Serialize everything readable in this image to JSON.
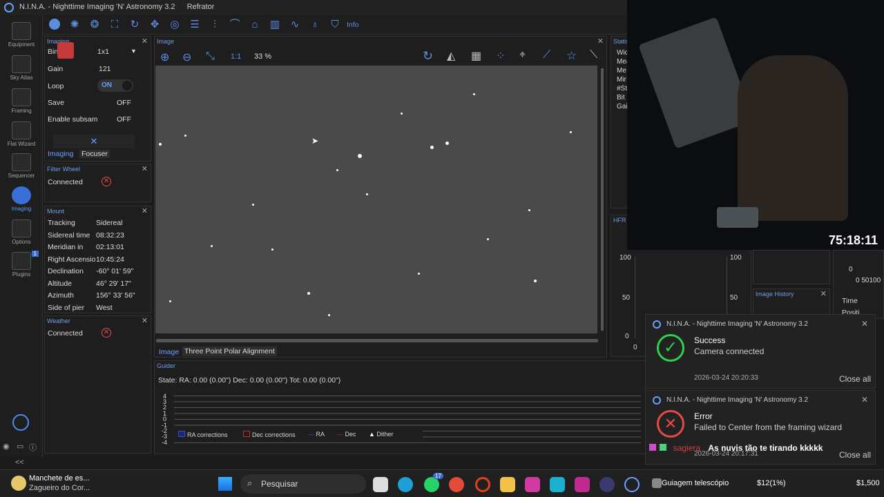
{
  "window": {
    "title": "N.I.N.A. - Nighttime Imaging 'N' Astronomy 3.2",
    "profile": "Refrator"
  },
  "nav": [
    "Equipment",
    "Sky Atlas",
    "Framing",
    "Flat Wizard",
    "Sequencer",
    "Imaging",
    "Options",
    "Plugins"
  ],
  "plugins_badge": "1",
  "toolbar": {
    "info_label": "Info"
  },
  "imaging_panel": {
    "header": "Imaging",
    "bin_label": "Bin",
    "bin_value": "1x1",
    "gain_label": "Gain",
    "gain_value": "121",
    "loop_label": "Loop",
    "loop_value": "ON",
    "save_label": "Save",
    "save_value": "OFF",
    "subsam_label": "Enable subsam",
    "subsam_value": "OFF",
    "tabs": [
      "Imaging",
      "Focuser"
    ]
  },
  "filter_wheel": {
    "header": "Filter Wheel",
    "status": "Connected"
  },
  "mount": {
    "header": "Mount",
    "rows": [
      {
        "label": "Tracking",
        "value": "Sidereal"
      },
      {
        "label": "Sidereal time",
        "value": "08:32:23"
      },
      {
        "label": "Meridian in",
        "value": "02:13:01"
      },
      {
        "label": "Right Ascensio",
        "value": "10:45:24"
      },
      {
        "label": "Declination",
        "value": "-60° 01' 59\""
      },
      {
        "label": "Altitude",
        "value": "46° 29' 17\""
      },
      {
        "label": "Azimuth",
        "value": "156° 33' 56\""
      },
      {
        "label": "Side of pier",
        "value": "West"
      }
    ]
  },
  "weather": {
    "header": "Weather",
    "status": "Connected"
  },
  "image_panel": {
    "header": "Image",
    "ratio": "1:1",
    "zoom": "33 %",
    "tabs": [
      "Image",
      "Three Point Polar Alignment"
    ]
  },
  "statistics": {
    "header": "Statisti",
    "rows": [
      "Wic",
      "Mea",
      "Me",
      "Mir",
      "#St",
      "Bit",
      "Gai"
    ]
  },
  "hfr": {
    "header": "HFR H",
    "y_ticks": [
      "100",
      "50",
      "0"
    ],
    "x0": "0"
  },
  "right_panel": {
    "ticks": [
      "0",
      "0 50100"
    ],
    "image_history": "Image History",
    "time_label": "Time",
    "position_label": "Positi"
  },
  "guider": {
    "header": "Guider",
    "state": "State:  RA: 0.00 (0.00\")  Dec: 0.00 (0.00\")  Tot: 0.00 (0.00\")",
    "y_ticks": [
      "4",
      "3",
      "2",
      "1",
      "0",
      "-1",
      "-2",
      "-3",
      "-4"
    ],
    "legend": [
      "RA corrections",
      "Dec corrections",
      "RA",
      "Dec",
      "Dither"
    ]
  },
  "stream": {
    "timer": "75:18:11",
    "chat_user": "sagiera",
    "chat_message": "As nuvis tão te tirando kkkkk"
  },
  "toasts": [
    {
      "app": "N.I.N.A. - Nighttime Imaging 'N' Astronomy 3.2",
      "title": "Success",
      "message": "Camera connected",
      "time": "2026-03-24 20:20:33",
      "action": "Close all"
    },
    {
      "app": "N.I.N.A. - Nighttime Imaging 'N' Astronomy 3.2",
      "title": "Error",
      "message": "Failed to Center from the framing wizard",
      "time": "2026-03-24 20:17:31",
      "action": "Close all"
    }
  ],
  "taskbar": {
    "news_title": "Manchete de es...",
    "news_sub": "Zagueiro do Cor...",
    "search": "Pesquisar",
    "whatsapp_badge": "17",
    "obs_label": "Guiagem telescópio",
    "ticker1": "$12(1%)",
    "ticker2": "$1,500"
  }
}
